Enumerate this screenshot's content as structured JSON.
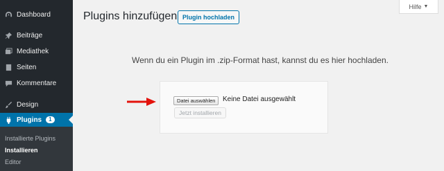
{
  "sidebar": {
    "items": [
      {
        "label": "Dashboard",
        "icon": "dashboard-icon"
      },
      {
        "label": "Beiträge",
        "icon": "pin-icon"
      },
      {
        "label": "Mediathek",
        "icon": "media-icon"
      },
      {
        "label": "Seiten",
        "icon": "pages-icon"
      },
      {
        "label": "Kommentare",
        "icon": "comments-icon"
      },
      {
        "label": "Design",
        "icon": "brush-icon"
      },
      {
        "label": "Plugins",
        "icon": "plugin-icon",
        "badge": "1"
      }
    ],
    "submenu": [
      {
        "label": "Installierte Plugins"
      },
      {
        "label": "Installieren"
      },
      {
        "label": "Editor"
      }
    ]
  },
  "help_tab": {
    "label": "Hilfe",
    "caret": "▼"
  },
  "header": {
    "title": "Plugins hinzufügen",
    "upload_button": "Plugin hochladen"
  },
  "upload": {
    "instruction": "Wenn du ein Plugin im .zip-Format hast, kannst du es hier hochladen.",
    "file_button": "Datei auswählen",
    "file_status": "Keine Datei ausgewählt",
    "install_button": "Jetzt installieren"
  },
  "colors": {
    "sidebar_bg": "#23282d",
    "active_bg": "#0073aa",
    "arrow": "#e3120b"
  }
}
